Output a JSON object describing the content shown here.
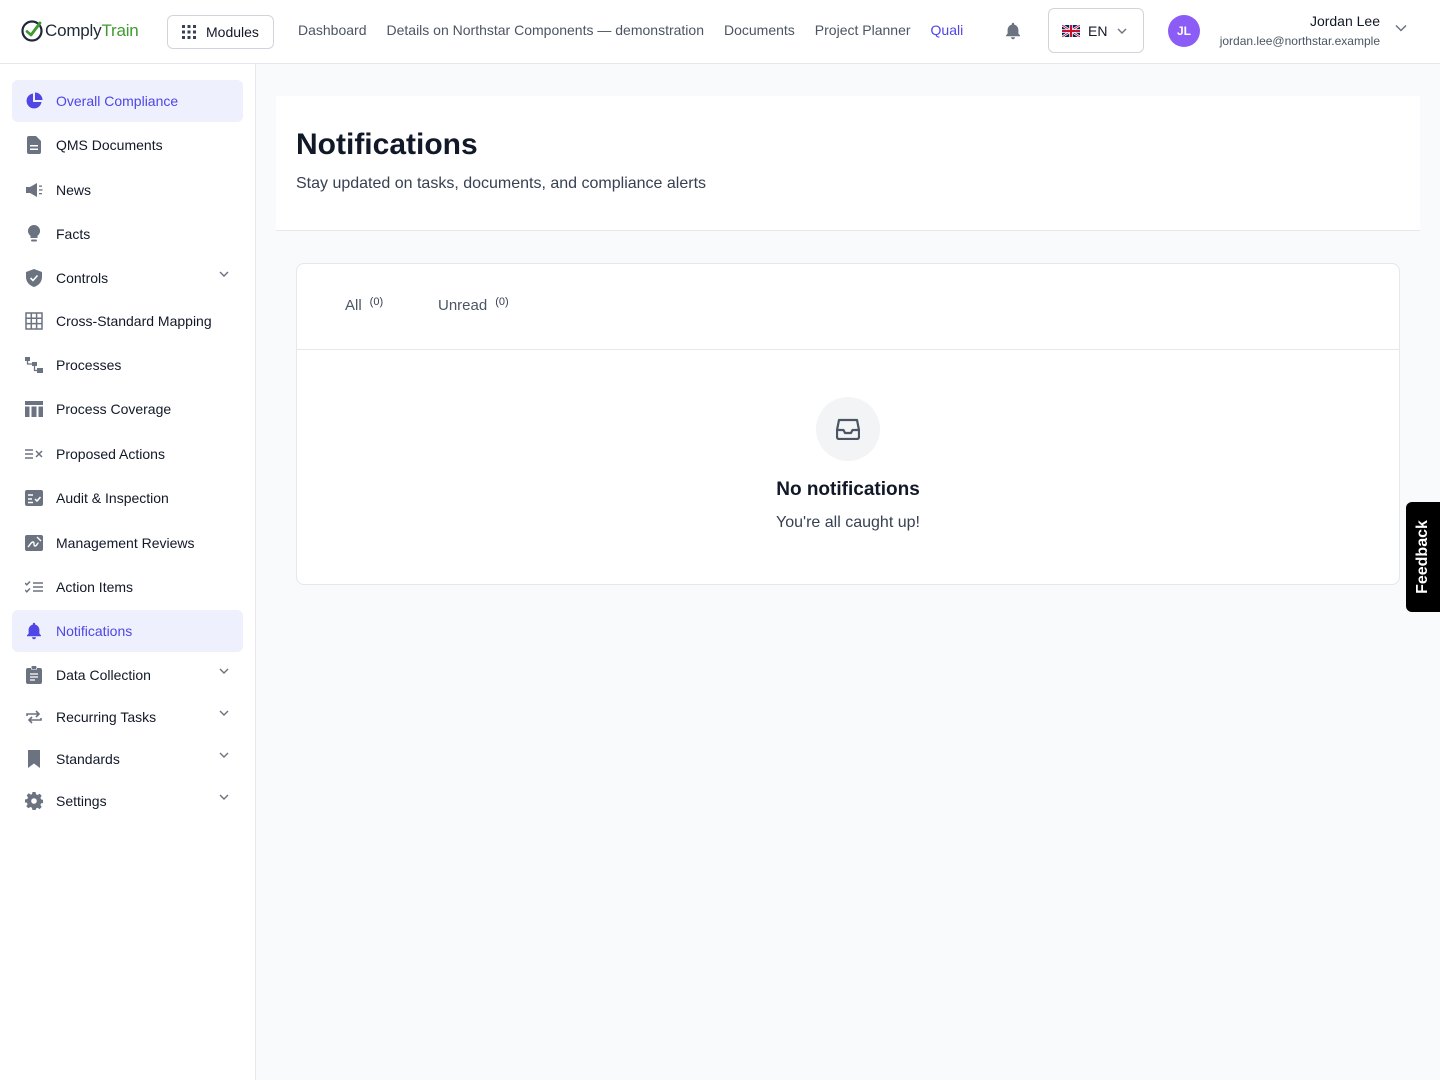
{
  "brand": {
    "name_part1": "Comply",
    "name_part2": "Train",
    "accent_color": "#3f9a2f"
  },
  "topbar": {
    "modules_label": "Modules",
    "nav": [
      {
        "label": "Dashboard"
      },
      {
        "label": "Details on Northstar Components — demonstration"
      },
      {
        "label": "Documents"
      },
      {
        "label": "Project Planner"
      },
      {
        "label": "Quali"
      }
    ],
    "language": {
      "code": "EN",
      "flag_icon": "uk-flag-icon"
    },
    "user": {
      "initials": "JL",
      "name": "Jordan Lee",
      "email": "jordan.lee@northstar.example",
      "avatar_color": "#8b5cf6"
    }
  },
  "sidebar": {
    "items": [
      {
        "label": "Overall Compliance",
        "icon": "pie-chart-icon",
        "active": false,
        "highlighted": true
      },
      {
        "label": "QMS Documents",
        "icon": "document-icon"
      },
      {
        "label": "News",
        "icon": "megaphone-icon"
      },
      {
        "label": "Facts",
        "icon": "lightbulb-icon"
      },
      {
        "label": "Controls",
        "icon": "shield-icon",
        "expandable": true
      },
      {
        "label": "Cross-Standard Mapping",
        "icon": "grid-icon"
      },
      {
        "label": "Processes",
        "icon": "process-icon"
      },
      {
        "label": "Process Coverage",
        "icon": "table-icon"
      },
      {
        "label": "Proposed Actions",
        "icon": "list-x-icon"
      },
      {
        "label": "Audit & Inspection",
        "icon": "checklist-card-icon"
      },
      {
        "label": "Management Reviews",
        "icon": "signature-icon"
      },
      {
        "label": "Action Items",
        "icon": "list-check-icon"
      },
      {
        "label": "Notifications",
        "icon": "bell-icon",
        "active": true
      },
      {
        "label": "Data Collection",
        "icon": "clipboard-icon",
        "expandable": true
      },
      {
        "label": "Recurring Tasks",
        "icon": "repeat-icon",
        "expandable": true
      },
      {
        "label": "Standards",
        "icon": "bookmark-icon",
        "expandable": true
      },
      {
        "label": "Settings",
        "icon": "gear-icon",
        "expandable": true
      }
    ],
    "accent_color": "#4f46e5"
  },
  "page": {
    "title": "Notifications",
    "subtitle": "Stay updated on tasks, documents, and compliance alerts"
  },
  "tabs": [
    {
      "label": "All",
      "count": "(0)"
    },
    {
      "label": "Unread",
      "count": "(0)"
    }
  ],
  "empty_state": {
    "icon": "inbox-icon",
    "title": "No notifications",
    "subtitle": "You're all caught up!"
  },
  "feedback_label": "Feedback"
}
